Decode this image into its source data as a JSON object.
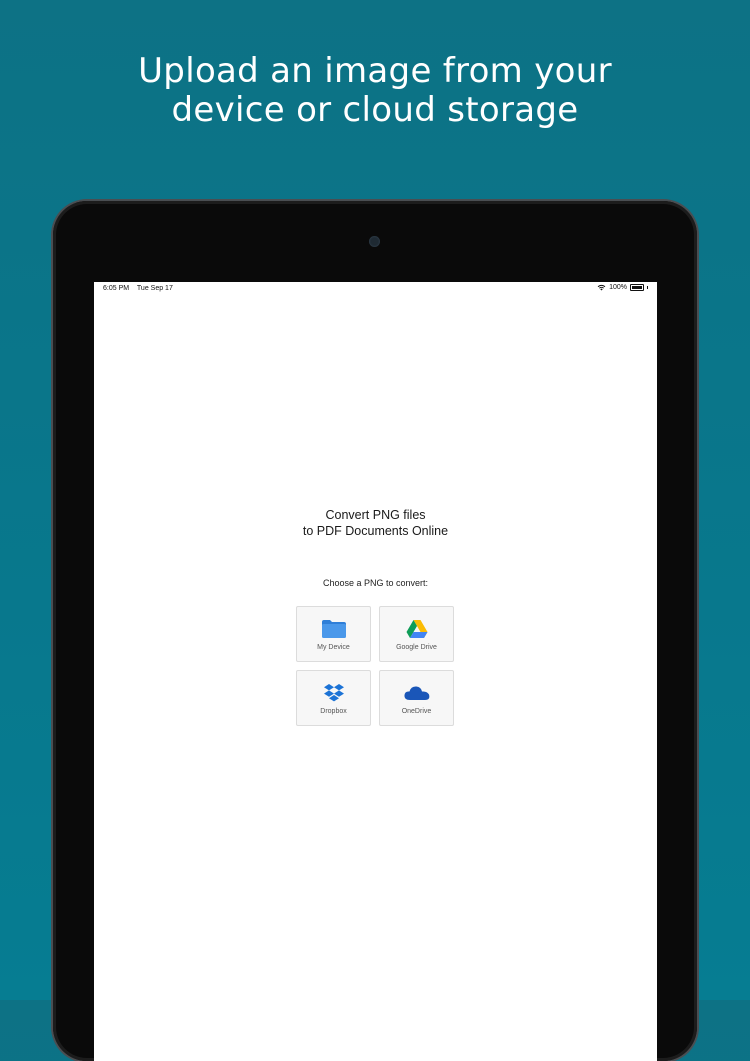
{
  "headline": {
    "line1": "Upload an image from your",
    "line2": "device or cloud storage"
  },
  "status_bar": {
    "time": "6:05 PM",
    "date": "Tue Sep 17",
    "battery": "100%"
  },
  "converter": {
    "title_line1": "Convert PNG files",
    "title_line2": "to PDF Documents Online",
    "prompt": "Choose a PNG to convert:",
    "sources": [
      {
        "label": "My Device",
        "icon": "folder-icon"
      },
      {
        "label": "Google Drive",
        "icon": "google-drive-icon"
      },
      {
        "label": "Dropbox",
        "icon": "dropbox-icon"
      },
      {
        "label": "OneDrive",
        "icon": "onedrive-icon"
      }
    ]
  },
  "colors": {
    "background": "#0b7589",
    "device_frame": "#0a0a0a",
    "folder_blue": "#3b8de3",
    "dropbox_blue": "#1c73d6",
    "onedrive_blue": "#1a56b8"
  }
}
